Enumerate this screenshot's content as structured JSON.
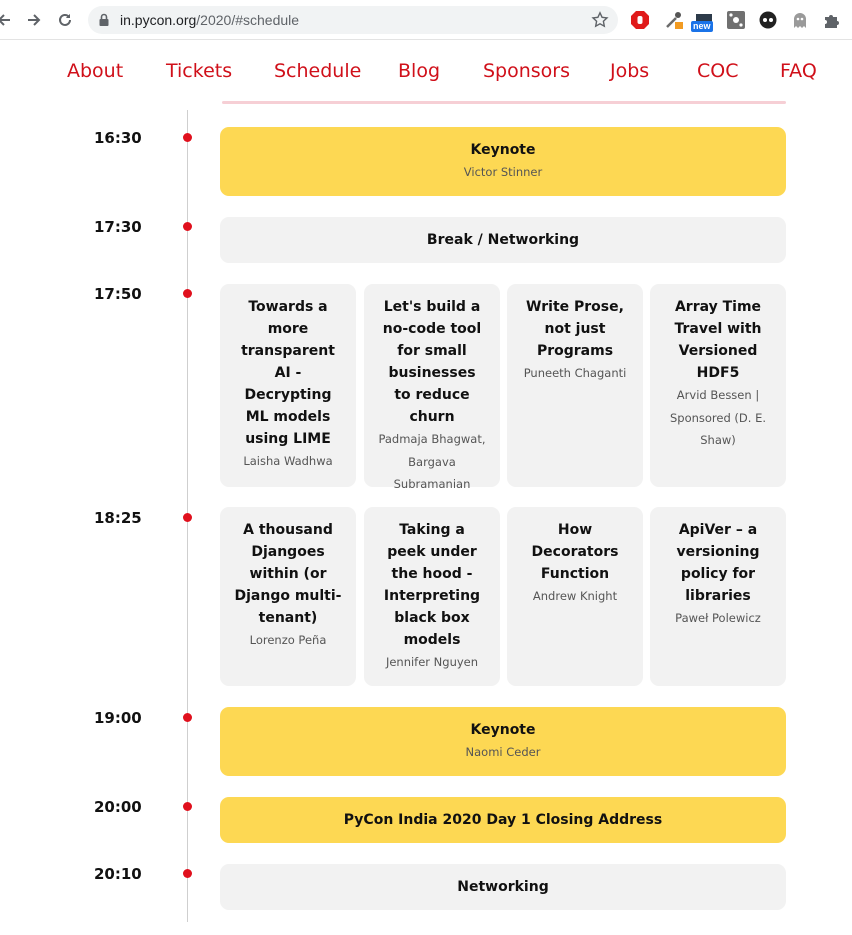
{
  "browser": {
    "url_host": "in.pycon.org",
    "url_path": "/2020/#schedule",
    "new_badge": "new"
  },
  "nav": {
    "items": [
      "About",
      "Tickets",
      "Schedule",
      "Blog",
      "Sponsors",
      "Jobs",
      "COC",
      "FAQ"
    ]
  },
  "schedule": [
    {
      "time": "16:30",
      "title": "Keynote",
      "speaker": "Victor Stinner"
    },
    {
      "time": "17:30",
      "title": "Break / Networking"
    },
    {
      "time": "17:50",
      "talks": [
        {
          "title": "Towards a more transparent AI - Decrypting ML models using LIME",
          "speaker": "Laisha Wadhwa"
        },
        {
          "title": "Let's build a no-code tool for small businesses to reduce churn",
          "speaker": "Padmaja Bhagwat, Bargava Subramanian"
        },
        {
          "title": "Write Prose, not just Programs",
          "speaker": "Puneeth Chaganti"
        },
        {
          "title": "Array Time Travel with Versioned HDF5",
          "speaker": "Arvid Bessen | Sponsored (D. E. Shaw)"
        }
      ]
    },
    {
      "time": "18:25",
      "talks": [
        {
          "title": "A thousand Djangoes within (or Django multi-tenant)",
          "speaker": "Lorenzo Peña"
        },
        {
          "title": "Taking a peek under the hood - Interpreting black box models",
          "speaker": "Jennifer Nguyen"
        },
        {
          "title": "How Decorators Function",
          "speaker": "Andrew Knight"
        },
        {
          "title": "ApiVer – a versioning policy for libraries",
          "speaker": "Paweł Polewicz"
        }
      ]
    },
    {
      "time": "19:00",
      "title": "Keynote",
      "speaker": "Naomi Ceder"
    },
    {
      "time": "20:00",
      "title": "PyCon India 2020 Day 1 Closing Address"
    },
    {
      "time": "20:10",
      "title": "Networking"
    }
  ],
  "colors": {
    "accent_red": "#d0101a",
    "keynote_yellow": "#fdd853",
    "card_gray": "#f2f2f2"
  },
  "icons": [
    "back-arrow-icon",
    "forward-arrow-icon",
    "reload-icon",
    "lock-icon",
    "star-icon",
    "adblock-icon",
    "eyedropper-icon",
    "new-extension-icon",
    "hub-icon",
    "spy-icon",
    "ghost-icon",
    "puzzle-icon"
  ]
}
